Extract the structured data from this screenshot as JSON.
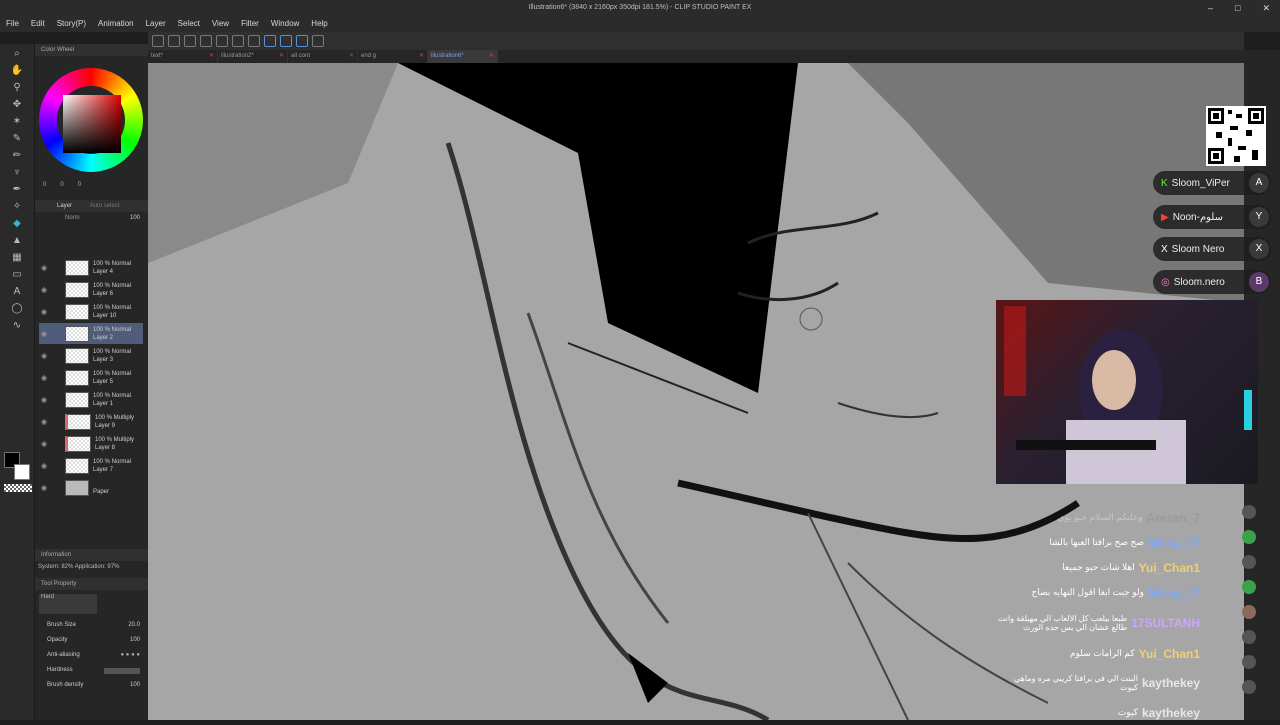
{
  "window": {
    "title": "Illustration6* (3840 x 2160px 350dpi 181.5%) - CLIP STUDIO PAINT EX",
    "controls": [
      "–",
      "□",
      "✕"
    ]
  },
  "menu": [
    "File",
    "Edit",
    "Story(P)",
    "Animation",
    "Layer",
    "Select",
    "View",
    "Filter",
    "Window",
    "Help"
  ],
  "tabs": [
    {
      "label": "text*",
      "active": false
    },
    {
      "label": "illustration2*",
      "active": false
    },
    {
      "label": "all cont",
      "active": false
    },
    {
      "label": "end g",
      "active": false
    },
    {
      "label": "illustration6*",
      "active": true
    }
  ],
  "color_wheel": {
    "title": "Color Wheel",
    "values": [
      "0",
      "0",
      "0"
    ]
  },
  "layer_panel": {
    "title": "Layer",
    "autoselect": "Auto select",
    "blend": "Norm",
    "opacity": "100",
    "layers": [
      {
        "mode": "100 % Normal",
        "name": "Layer 4"
      },
      {
        "mode": "100 % Normal",
        "name": "Layer 6"
      },
      {
        "mode": "100 % Normal",
        "name": "Layer 10"
      },
      {
        "mode": "100 % Normal",
        "name": "Layer 2",
        "selected": true
      },
      {
        "mode": "100 % Normal",
        "name": "Layer 3"
      },
      {
        "mode": "100 % Normal",
        "name": "Layer 5"
      },
      {
        "mode": "100 % Normal",
        "name": "Layer 1"
      },
      {
        "mode": "100 % Multiply",
        "name": "Layer 9"
      },
      {
        "mode": "100 % Multiply",
        "name": "Layer 8"
      },
      {
        "mode": "100 % Normal",
        "name": "Layer 7"
      },
      {
        "mode": "",
        "name": "Paper"
      }
    ]
  },
  "info_panel": {
    "title": "Information",
    "system": "System: 82%",
    "application": "Application: 97%"
  },
  "tool_property": {
    "title": "Tool Property",
    "brush": "Hard",
    "rows": [
      {
        "label": "Brush Size",
        "value": "20.0"
      },
      {
        "label": "Opacity",
        "value": "100"
      },
      {
        "label": "Anti-aliasing",
        "value": ""
      },
      {
        "label": "Hardness",
        "value": ""
      },
      {
        "label": "Brush density",
        "value": "100"
      }
    ]
  },
  "socials": [
    {
      "icon": "K",
      "handle": "Sloom_ViPer",
      "badge": "A"
    },
    {
      "icon": "▶",
      "handle": "Noon-سلوم",
      "badge": "Y"
    },
    {
      "icon": "X",
      "handle": "Sloom Nero",
      "badge": "X"
    },
    {
      "icon": "◎",
      "handle": "Sloom.nero",
      "badge": "B"
    }
  ],
  "chat": [
    {
      "user": "Arezan_7",
      "text": "وعليكم السلام حبو بوي",
      "color": "#888888",
      "faded": true
    },
    {
      "user": "Mirna_77",
      "text": "صح صح برافتا العبها بالشا",
      "color": "#7aa7ff"
    },
    {
      "user": "Yui_Chan1",
      "text": "اهلا شات حبو جميعا",
      "color": "#f0d070"
    },
    {
      "user": "Mirna_77",
      "text": "ولو جبت ابغا اقول النهايه بصاح",
      "color": "#7aa7ff"
    },
    {
      "user": "17SULTANH",
      "text": "طبعا بيلعب كل الالعاب الي مهيلقة وانت طالع عشان الي بس حده الورث",
      "color": "#c9a6ff"
    },
    {
      "user": "Yui_Chan1",
      "text": "كم الرامات سلوم",
      "color": "#f0d070"
    },
    {
      "user": "kaythekey",
      "text": "البنت الي في برافتا كريبي مره وماهي كيوت",
      "color": "#e8e8e8"
    },
    {
      "user": "kaythekey",
      "text": "كيوت",
      "color": "#e8e8e8"
    }
  ]
}
